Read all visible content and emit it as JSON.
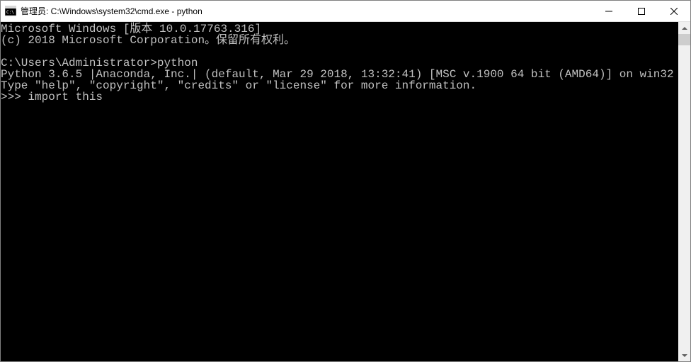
{
  "window": {
    "title": "管理员: C:\\Windows\\system32\\cmd.exe - python"
  },
  "console": {
    "lines": [
      "Microsoft Windows [版本 10.0.17763.316]",
      "(c) 2018 Microsoft Corporation。保留所有权利。",
      "",
      "C:\\Users\\Administrator>python",
      "Python 3.6.5 |Anaconda, Inc.| (default, Mar 29 2018, 13:32:41) [MSC v.1900 64 bit (AMD64)] on win32",
      "Type \"help\", \"copyright\", \"credits\" or \"license\" for more information.",
      ">>> import this"
    ]
  }
}
